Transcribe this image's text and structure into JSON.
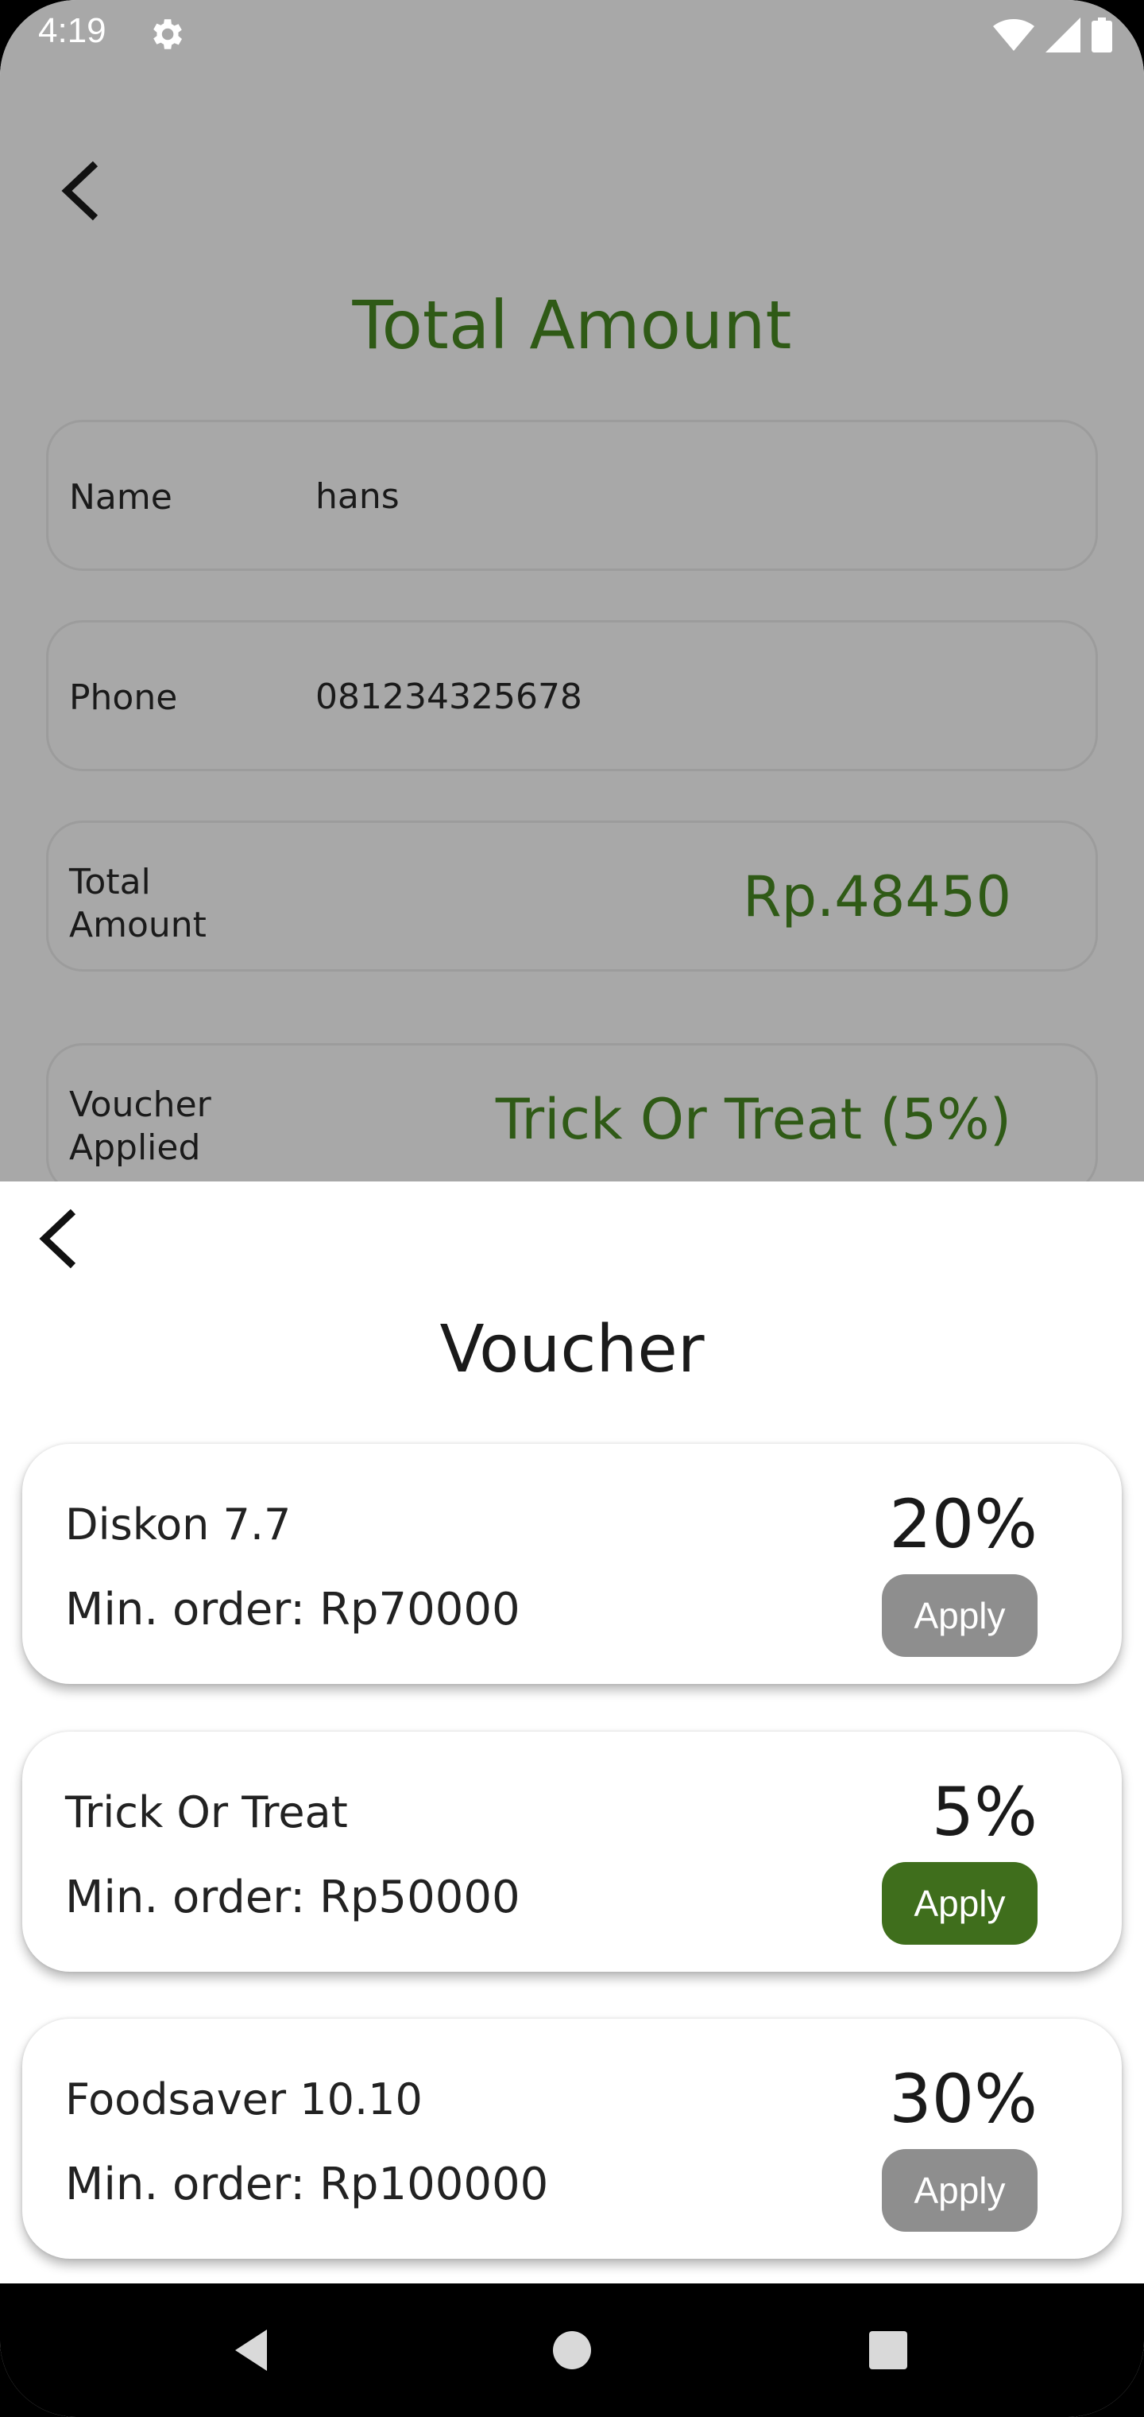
{
  "status_bar": {
    "time": "4:19"
  },
  "background_page": {
    "title": "Total Amount",
    "name_label": "Name",
    "name_value": "hans",
    "phone_label": "Phone",
    "phone_value": "081234325678",
    "total_label_line1": "Total",
    "total_label_line2": "Amount",
    "total_value": "Rp.48450",
    "voucher_label_line1": "Voucher",
    "voucher_label_line2": "Applied",
    "voucher_value": "Trick Or Treat (5%)"
  },
  "sheet": {
    "title": "Voucher",
    "vouchers": [
      {
        "name": "Diskon 7.7",
        "min_order": "Min. order: Rp70000",
        "percent": "20%",
        "apply_label": "Apply",
        "state": "disabled"
      },
      {
        "name": "Trick Or Treat",
        "min_order": "Min. order: Rp50000",
        "percent": "5%",
        "apply_label": "Apply",
        "state": "active"
      },
      {
        "name": "Foodsaver 10.10",
        "min_order": "Min. order: Rp100000",
        "percent": "30%",
        "apply_label": "Apply",
        "state": "disabled"
      }
    ]
  },
  "colors": {
    "accent_green": "#3f6e1c",
    "disabled_gray": "#8e8e8e",
    "title_green": "#2f5a16"
  },
  "icons": [
    "gear-icon",
    "wifi-icon",
    "signal-icon",
    "battery-icon",
    "back-arrow-icon",
    "nav-back-icon",
    "nav-home-icon",
    "nav-recents-icon"
  ]
}
